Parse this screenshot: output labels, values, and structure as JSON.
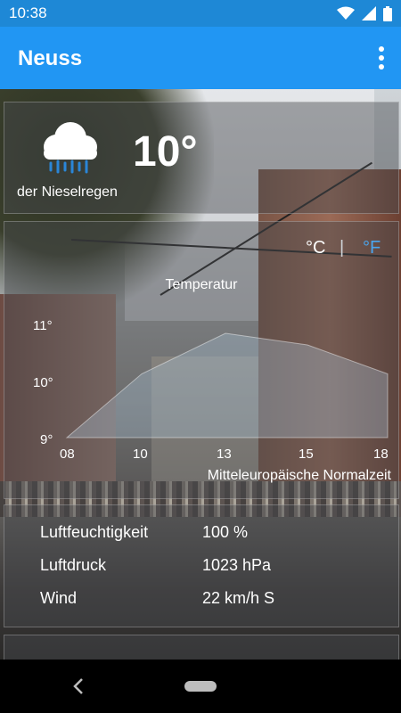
{
  "status_bar": {
    "time": "10:38"
  },
  "app_bar": {
    "title": "Neuss"
  },
  "current": {
    "temperature": "10°",
    "description": "der Nieselregen",
    "icon": "drizzle-cloud-icon"
  },
  "units": {
    "celsius": "°C",
    "separator": "|",
    "fahrenheit": "°F",
    "active": "celsius"
  },
  "chart_data": {
    "type": "area",
    "title": "Temperatur",
    "x": [
      "08",
      "10",
      "13",
      "15",
      "18"
    ],
    "values": [
      9,
      10.1,
      10.8,
      10.6,
      10.1
    ],
    "y_ticks": [
      "9°",
      "10°",
      "11°"
    ],
    "ylim": [
      9,
      11.4
    ],
    "xlabel": "Mitteleuropäische Normalzeit",
    "ylabel": ""
  },
  "details": [
    {
      "label": "Luftfeuchtigkeit",
      "value": "100 %"
    },
    {
      "label": "Luftdruck",
      "value": "1023 hPa"
    },
    {
      "label": "Wind",
      "value": "22 km/h S"
    }
  ],
  "colors": {
    "status_bar": "#1e88d6",
    "app_bar": "#2196f3",
    "unit_active": "#ffffff",
    "unit_inactive": "#4aa6f0"
  }
}
